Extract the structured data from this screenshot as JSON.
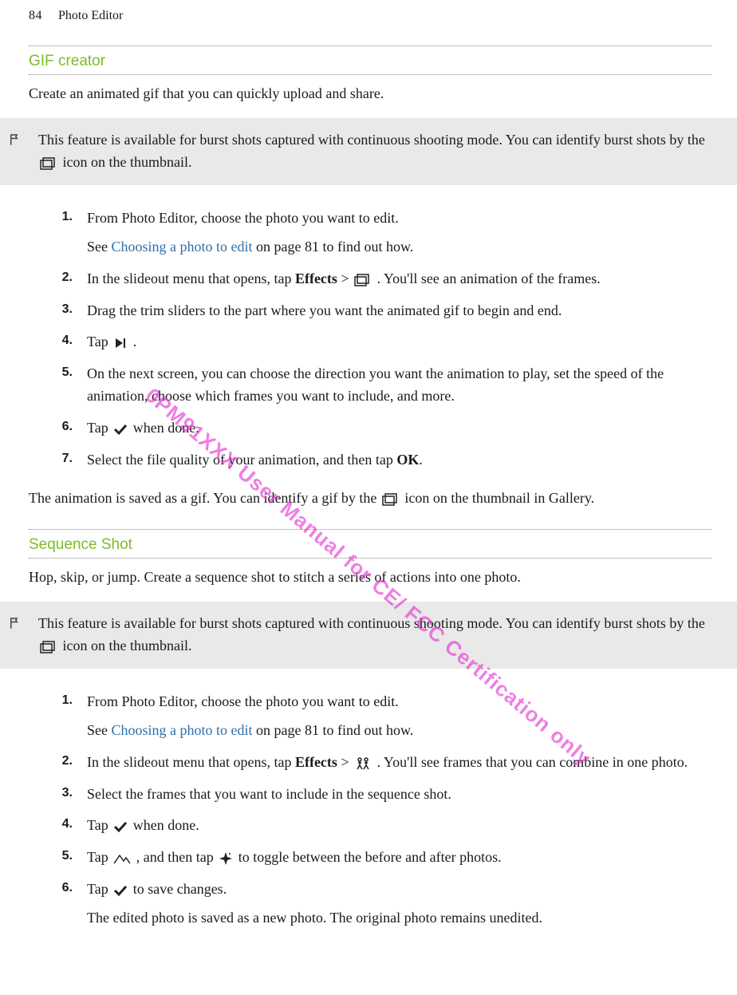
{
  "header": {
    "page_number": "84",
    "title": "Photo Editor"
  },
  "gif": {
    "heading": "GIF creator",
    "intro": "Create an animated gif that you can quickly upload and share.",
    "note_pre": "This feature is available for burst shots captured with continuous shooting mode. You can identify burst shots by the ",
    "note_post": " icon on the thumbnail.",
    "step1a": "From Photo Editor, choose the photo you want to edit.",
    "step1b_pre": "See ",
    "step1b_link": "Choosing a photo to edit",
    "step1b_post": " on page 81 to find out how.",
    "step2_pre": "In the slideout menu that opens, tap ",
    "step2_bold": "Effects",
    "step2_mid": " > ",
    "step2_post": " . You'll see an animation of the frames.",
    "step3": "Drag the trim sliders to the part where you want the animated gif to begin and end.",
    "step4_pre": "Tap ",
    "step4_post": " .",
    "step5": "On the next screen, you can choose the direction you want the animation to play, set the speed of the animation, choose which frames you want to include, and more.",
    "step6_pre": "Tap ",
    "step6_post": " when done.",
    "step7_pre": "Select the file quality of your animation, and then tap ",
    "step7_bold": "OK",
    "step7_post": ".",
    "closing_pre": "The animation is saved as a gif. You can identify a gif by the ",
    "closing_post": " icon on the thumbnail in Gallery."
  },
  "seq": {
    "heading": "Sequence Shot",
    "intro": "Hop, skip, or jump. Create a sequence shot to stitch a series of actions into one photo.",
    "note_pre": "This feature is available for burst shots captured with continuous shooting mode. You can identify burst shots by the ",
    "note_post": " icon on the thumbnail.",
    "step1a": "From Photo Editor, choose the photo you want to edit.",
    "step1b_pre": "See ",
    "step1b_link": "Choosing a photo to edit",
    "step1b_post": " on page 81 to find out how.",
    "step2_pre": "In the slideout menu that opens, tap ",
    "step2_bold": "Effects",
    "step2_mid": " > ",
    "step2_post": " . You'll see frames that you can combine in one photo.",
    "step3": "Select the frames that you want to include in the sequence shot.",
    "step4_pre": "Tap ",
    "step4_post": " when done.",
    "step5_pre": "Tap ",
    "step5_mid": " , and then tap ",
    "step5_post": " to toggle between the before and after photos.",
    "step6_pre": "Tap ",
    "step6_post": " to save changes.",
    "step6_note": "The edited photo is saved as a new photo. The original photo remains unedited."
  },
  "watermark": "0PM91XXX User Manual for CE/ FCC Certification only",
  "nums": {
    "n1": "1.",
    "n2": "2.",
    "n3": "3.",
    "n4": "4.",
    "n5": "5.",
    "n6": "6.",
    "n7": "7."
  }
}
